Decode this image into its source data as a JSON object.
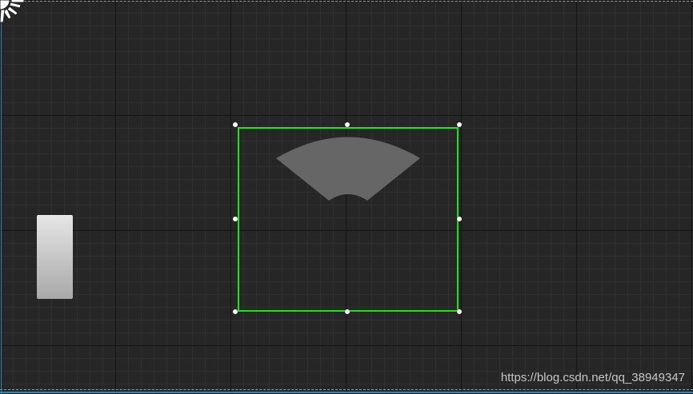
{
  "canvas": {
    "background_color": "#262626",
    "grid_major_color": "#141414",
    "grid_minor_color": "#303030",
    "frame_edge_color": "#1a8fb8",
    "selection_color": "#19e619",
    "shape_fill_color": "#666666"
  },
  "icons": {
    "anchor": "anchor-icon"
  },
  "watermark": "https://blog.csdn.net/qq_38949347"
}
